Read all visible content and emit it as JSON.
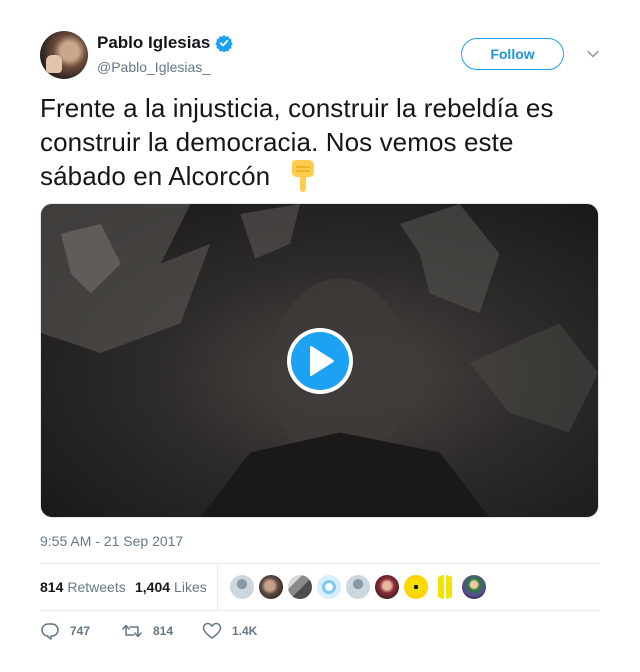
{
  "author": {
    "name": "Pablo Iglesias",
    "handle": "@Pablo_Iglesias_",
    "verified": true
  },
  "follow_button": {
    "label": "Follow"
  },
  "tweet": {
    "text": "Frente a la injusticia, construir la rebeldía es construir la democracia. Nos vemos este sábado en Alcorcón",
    "emoji": "pointing-down-icon",
    "timestamp": "9:55 AM - 21 Sep 2017"
  },
  "video": {
    "play_icon": "play-icon"
  },
  "stats": {
    "retweets_count": "814",
    "retweets_label": "Retweets",
    "likes_count": "1,404",
    "likes_label": "Likes",
    "liker_avatars": 9
  },
  "actions": {
    "replies": "747",
    "retweets": "814",
    "likes": "1.4K"
  },
  "colors": {
    "accent": "#1da1f2",
    "text": "#14171a",
    "muted": "#657786"
  }
}
